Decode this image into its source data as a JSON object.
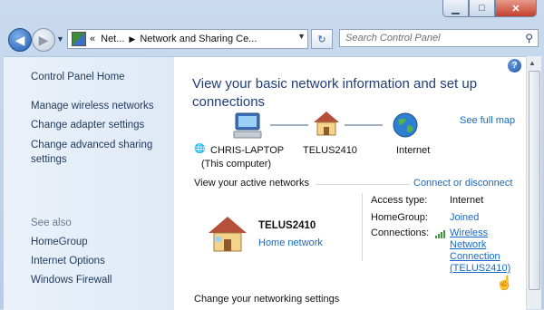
{
  "window": {
    "minimize": "▁",
    "maximize": "□",
    "close": "✕"
  },
  "nav": {
    "back": "◀",
    "forward": "▶",
    "recent": "▼",
    "breadcrumb": [
      "Net...",
      "Network and Sharing Ce..."
    ],
    "breadcrumb_overflow": "«",
    "refresh": "↻",
    "search_placeholder": "Search Control Panel"
  },
  "sidebar": {
    "home": "Control Panel Home",
    "items": [
      "Manage wireless networks",
      "Change adapter settings",
      "Change advanced sharing settings"
    ],
    "see_also_label": "See also",
    "see_also": [
      "HomeGroup",
      "Internet Options",
      "Windows Firewall"
    ]
  },
  "main": {
    "title": "View your basic network information and set up connections",
    "see_full_map": "See full map",
    "map": {
      "computer_name": "CHRIS-LAPTOP",
      "computer_sub": "(This computer)",
      "network_name": "TELUS2410",
      "internet": "Internet"
    },
    "active_label": "View your active networks",
    "connect_link": "Connect or disconnect",
    "active": {
      "name": "TELUS2410",
      "type_link": "Home network",
      "access_label": "Access type:",
      "access_value": "Internet",
      "homegroup_label": "HomeGroup:",
      "homegroup_value": "Joined",
      "connections_label": "Connections:",
      "connection_lines": [
        "Wireless",
        "Network",
        "Connection",
        "(TELUS2410)"
      ]
    },
    "change_settings": "Change your networking settings"
  },
  "colors": {
    "accent": "#1569c7",
    "title": "#1e3d7b",
    "sidebar_text": "#1e395b"
  }
}
